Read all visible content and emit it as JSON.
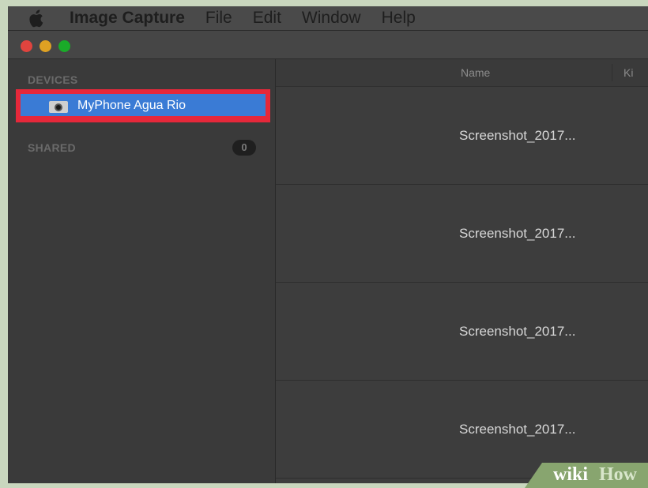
{
  "menubar": {
    "app_name": "Image Capture",
    "items": [
      "File",
      "Edit",
      "Window",
      "Help"
    ]
  },
  "window": {
    "traffic_lights": {
      "close": "#e0443e",
      "minimize": "#dea123",
      "zoom": "#1aab29"
    }
  },
  "sidebar": {
    "devices_label": "DEVICES",
    "device": {
      "label": "MyPhone Agua Rio",
      "icon": "camera-icon",
      "selected": true
    },
    "highlight_color": "#e5283a",
    "selection_color": "#3a7bd5",
    "shared_label": "SHARED",
    "shared_count": "0"
  },
  "main": {
    "columns": [
      "Name",
      "Ki"
    ],
    "rows": [
      {
        "name": "Screenshot_2017..."
      },
      {
        "name": "Screenshot_2017..."
      },
      {
        "name": "Screenshot_2017..."
      },
      {
        "name": "Screenshot_2017..."
      }
    ]
  },
  "watermark": {
    "part1": "wiki",
    "part2": "How"
  }
}
